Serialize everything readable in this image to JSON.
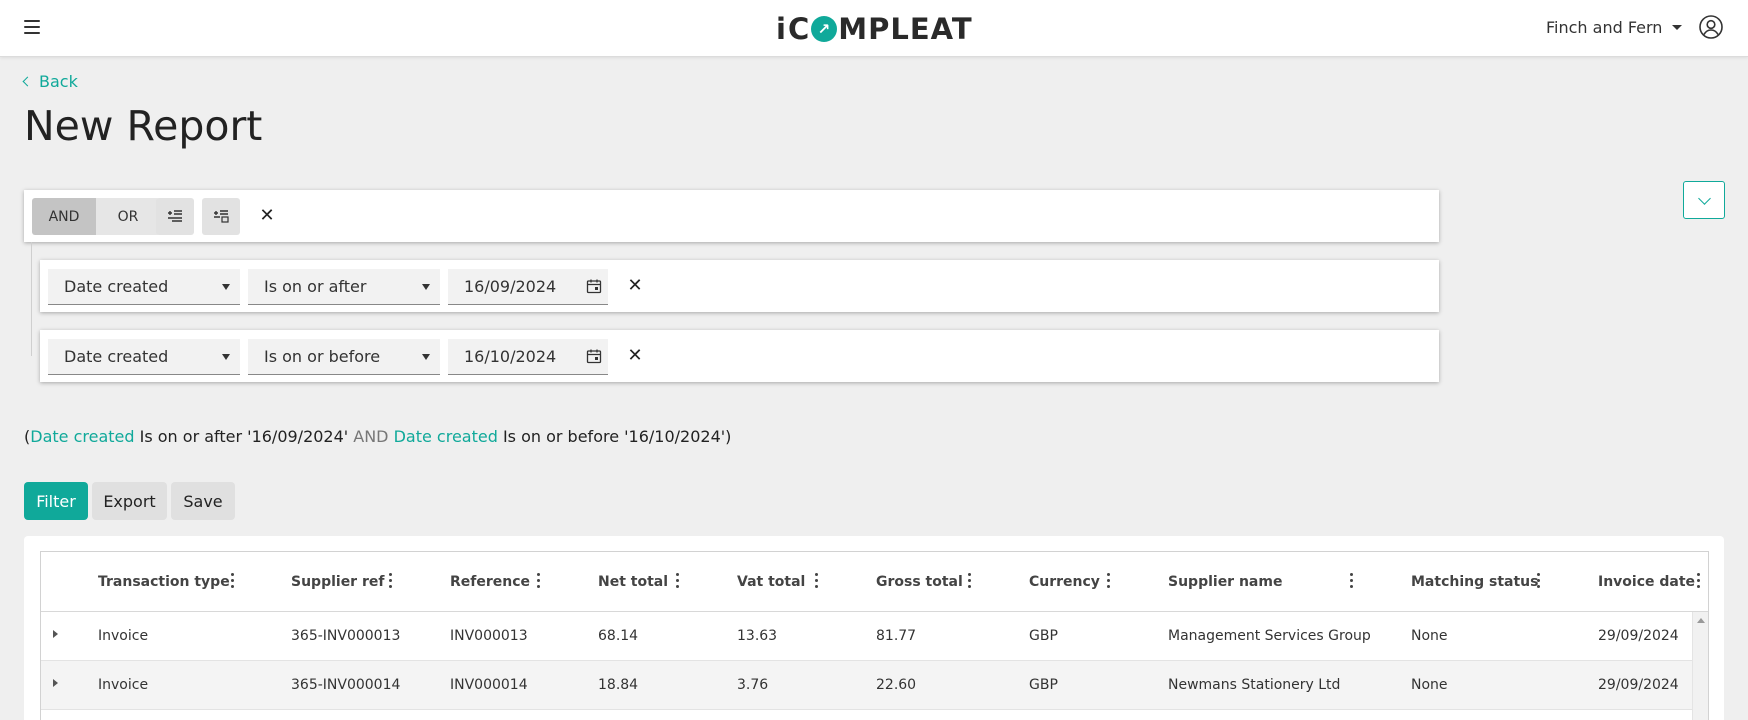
{
  "header": {
    "logo_pre": "i",
    "logo_post": "MPLEAT",
    "logo_ring_glyph": "↗",
    "organisation": "Finch and Fern"
  },
  "page": {
    "back_label": "Back",
    "title": "New Report"
  },
  "filter_group": {
    "and_label": "AND",
    "or_label": "OR",
    "active_operator": "AND",
    "conditions": [
      {
        "field": "Date created",
        "operator": "Is on or after",
        "value": "16/09/2024"
      },
      {
        "field": "Date created",
        "operator": "Is on or before",
        "value": "16/10/2024"
      }
    ]
  },
  "summary": {
    "open": "(",
    "field1": "Date created",
    "text1": " Is on or after '16/09/2024' ",
    "joiner": "AND",
    "field2": " Date created",
    "text2": " Is on or before '16/10/2024')"
  },
  "actions": {
    "filter_label": "Filter",
    "export_label": "Export",
    "save_label": "Save"
  },
  "grid": {
    "columns": [
      "Transaction type",
      "Supplier ref",
      "Reference",
      "Net total",
      "Vat total",
      "Gross total",
      "Currency",
      "Supplier name",
      "Matching status",
      "Invoice date"
    ],
    "rows": [
      [
        "Invoice",
        "365-INV000013",
        "INV000013",
        "68.14",
        "13.63",
        "81.77",
        "GBP",
        "Management Services Group",
        "None",
        "29/09/2024"
      ],
      [
        "Invoice",
        "365-INV000014",
        "INV000014",
        "18.84",
        "3.76",
        "22.60",
        "GBP",
        "Newmans Stationery Ltd",
        "None",
        "29/09/2024"
      ]
    ]
  },
  "colors": {
    "accent": "#10a99a",
    "segment_active": "#c4c4c4",
    "background": "#efefef"
  },
  "icons": {
    "menu": "hamburger-icon",
    "account": "user-circle-icon",
    "add_condition": "add-condition-icon",
    "add_group": "add-group-icon",
    "remove": "close-icon",
    "calendar": "calendar-icon",
    "collapse": "chevron-down-icon",
    "expand_row": "expand-row-icon",
    "column_menu": "kebab-icon"
  }
}
